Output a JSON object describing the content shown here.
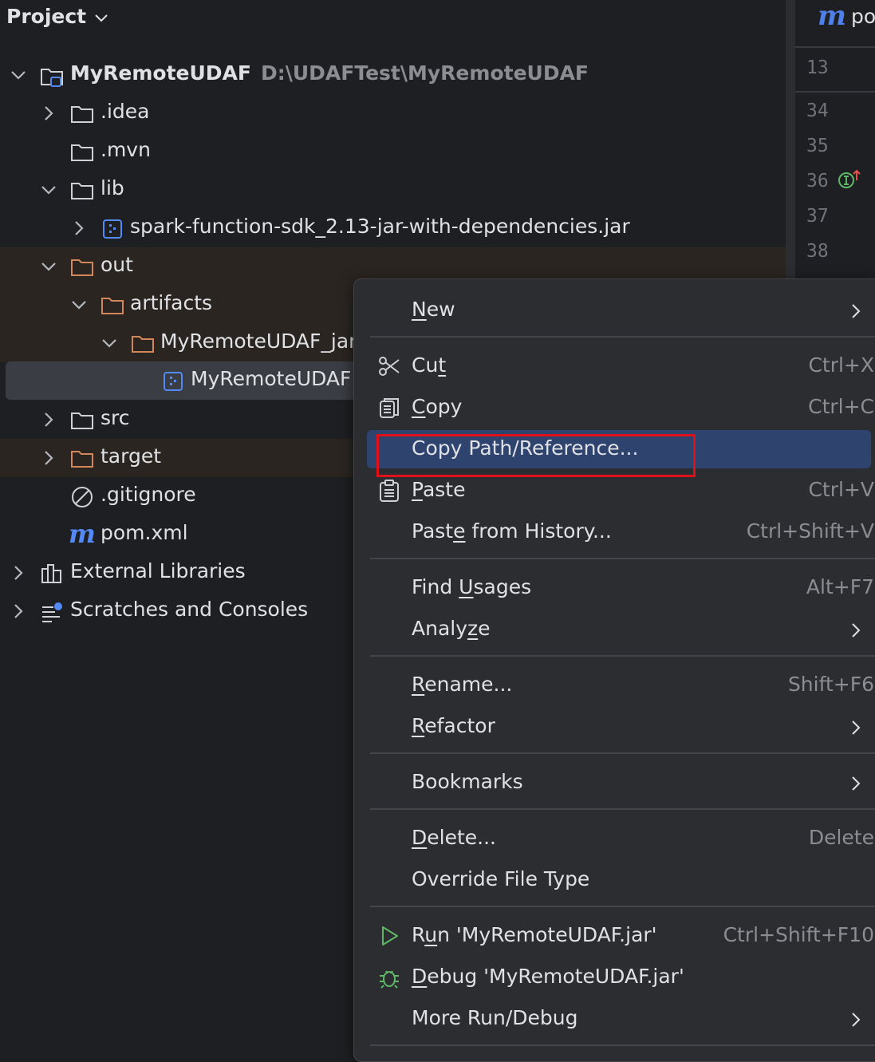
{
  "panel": {
    "title": "Project"
  },
  "tree": {
    "root": {
      "name": "MyRemoteUDAF",
      "path": "D:\\UDAFTest\\MyRemoteUDAF"
    },
    "idea": ".idea",
    "mvn": ".mvn",
    "lib": "lib",
    "spark_jar": "spark-function-sdk_2.13-jar-with-dependencies.jar",
    "out": "out",
    "artifacts": "artifacts",
    "artifact_dir": "MyRemoteUDAF_jar",
    "artifact_file": "MyRemoteUDAF",
    "src": "src",
    "target": "target",
    "gitignore": ".gitignore",
    "pom": "pom.xml",
    "external_libraries": "External Libraries",
    "scratches": "Scratches and Consoles"
  },
  "editor": {
    "tab_icon": "m",
    "tab_label": "po",
    "line_numbers": [
      "13",
      "34",
      "35",
      "36",
      "37",
      "38"
    ]
  },
  "menu": {
    "new": {
      "pre": "",
      "mn": "N",
      "post": "ew"
    },
    "cut": {
      "pre": "Cu",
      "mn": "t",
      "post": "",
      "shortcut": "Ctrl+X"
    },
    "copy": {
      "pre": "",
      "mn": "C",
      "post": "opy",
      "shortcut": "Ctrl+C"
    },
    "copy_path": "Copy Path/Reference...",
    "paste": {
      "pre": "",
      "mn": "P",
      "post": "aste",
      "shortcut": "Ctrl+V"
    },
    "paste_history": {
      "pre": "Past",
      "mn": "e",
      "post": " from History...",
      "shortcut": "Ctrl+Shift+V"
    },
    "find_usages": {
      "pre": "Find ",
      "mn": "U",
      "post": "sages",
      "shortcut": "Alt+F7"
    },
    "analyze": {
      "pre": "Analy",
      "mn": "z",
      "post": "e"
    },
    "rename": {
      "pre": "",
      "mn": "R",
      "post": "ename...",
      "shortcut": "Shift+F6"
    },
    "refactor": {
      "pre": "",
      "mn": "R",
      "post": "efactor"
    },
    "bookmarks": "Bookmarks",
    "delete": {
      "pre": "",
      "mn": "D",
      "post": "elete...",
      "shortcut": "Delete"
    },
    "override_file_type": "Override File Type",
    "run": {
      "pre": "R",
      "mn": "u",
      "post": "n 'MyRemoteUDAF.jar'",
      "shortcut": "Ctrl+Shift+F10"
    },
    "debug": {
      "pre": "",
      "mn": "D",
      "post": "ebug 'MyRemoteUDAF.jar'"
    },
    "more_run_debug": "More Run/Debug"
  },
  "colors": {
    "background": "#1e1f22",
    "menu_background": "#2b2d30",
    "highlight": "#2e436e",
    "annotation_box": "#e0101a",
    "folder_excluded": "#d4865b",
    "jar_icon": "#548af7"
  }
}
